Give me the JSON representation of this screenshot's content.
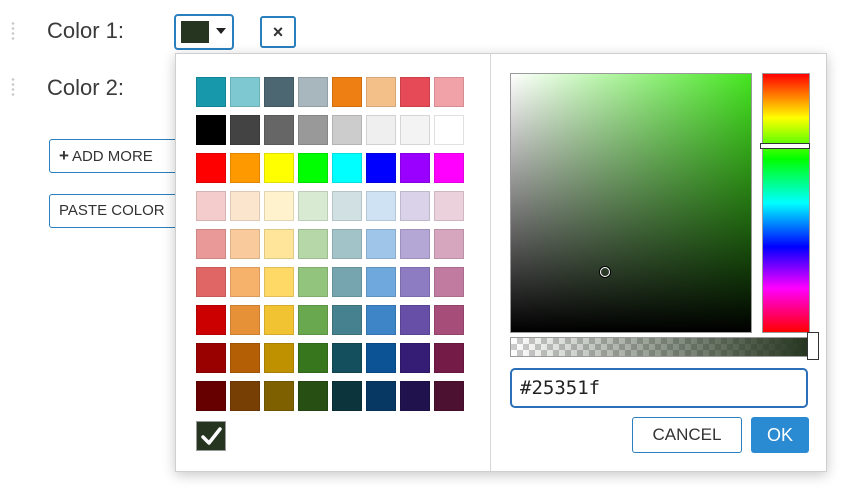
{
  "rows": [
    {
      "label": "Color 1:"
    },
    {
      "label": "Color 2:"
    }
  ],
  "current_color": "#25351f",
  "remove_icon": "×",
  "buttons": {
    "add_more": "ADD MORE",
    "paste_colors": "PASTE COLOR"
  },
  "palette": [
    [
      "#1798ab",
      "#7ec8d2",
      "#4c6672",
      "#a8b6bd",
      "#ee7f13",
      "#f4c08a",
      "#e64a57",
      "#f1a1a8"
    ],
    [
      "#000000",
      "#434343",
      "#666666",
      "#999999",
      "#cccccc",
      "#efefef",
      "#f3f3f3",
      "#ffffff"
    ],
    [
      "#ff0000",
      "#ff9900",
      "#ffff00",
      "#00ff00",
      "#00ffff",
      "#0000ff",
      "#9900ff",
      "#ff00ff"
    ],
    [
      "#f4cccc",
      "#fce5cd",
      "#fff2cc",
      "#d9ead3",
      "#d0e0e3",
      "#cfe2f3",
      "#d9d2e9",
      "#ead1dc"
    ],
    [
      "#ea9999",
      "#f9cb9c",
      "#ffe599",
      "#b6d7a8",
      "#a2c4c9",
      "#9fc5e8",
      "#b4a7d6",
      "#d5a6bd"
    ],
    [
      "#e06666",
      "#f6b26b",
      "#ffd966",
      "#93c47d",
      "#76a5af",
      "#6fa8dc",
      "#8e7cc3",
      "#c27ba0"
    ],
    [
      "#cc0000",
      "#e69138",
      "#f1c232",
      "#6aa84f",
      "#45818e",
      "#3d85c6",
      "#674ea7",
      "#a64d79"
    ],
    [
      "#990000",
      "#b45f06",
      "#bf9000",
      "#38761d",
      "#134f5c",
      "#0b5394",
      "#351c75",
      "#741b47"
    ],
    [
      "#660000",
      "#783f04",
      "#7f6000",
      "#274e13",
      "#0c343d",
      "#073763",
      "#20124d",
      "#4c1130"
    ]
  ],
  "picker": {
    "hue_color": "#45e620",
    "hex_value": "#25351f",
    "cancel_label": "CANCEL",
    "ok_label": "OK"
  },
  "icons": {
    "drag": "drag-handle-icon",
    "caret": "caret-down-icon",
    "remove": "close-icon",
    "plus": "plus-icon",
    "checkmark": "checkmark-icon"
  }
}
